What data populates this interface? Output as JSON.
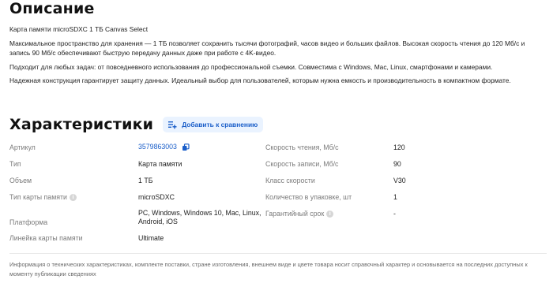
{
  "description": {
    "title": "Описание",
    "paragraphs": [
      "Карта памяти microSDXC 1 ТБ Canvas Select",
      "Максимальное пространство для хранения — 1 ТБ позволяет сохранить тысячи фотографий, часов видео и больших файлов. Высокая скорость чтения до 120 Мб/с и запись 90 Мб/с обеспечивают быструю передачу данных даже при работе с 4K-видео.",
      "Подходит для любых задач: от повседневного использования до профессиональной съемки. Совместима с Windows, Mac, Linux, смартфонами и камерами.",
      "Надежная конструкция гарантирует защиту данных. Идеальный выбор для пользователей, которым нужна емкость и производительность в компактном формате."
    ]
  },
  "specs": {
    "title": "Характеристики",
    "compare_label": "Добавить к сравнению",
    "left": [
      {
        "label": "Артикул",
        "value": "3579863003"
      },
      {
        "label": "Тип",
        "value": "Карта памяти"
      },
      {
        "label": "Объем",
        "value": "1 ТБ"
      },
      {
        "label": "Тип карты памяти",
        "value": "microSDXC"
      },
      {
        "label": "Платформа",
        "value": "PC, Windows, Windows 10, Mac, Linux, Android, iOS"
      },
      {
        "label": "Линейка карты памяти",
        "value": "Ultimate"
      }
    ],
    "right": [
      {
        "label": "Скорость чтения, Мб/с",
        "value": "120"
      },
      {
        "label": "Скорость записи, Мб/с",
        "value": "90"
      },
      {
        "label": "Класс скорости",
        "value": "V30"
      },
      {
        "label": "Количество в упаковке, шт",
        "value": "1"
      },
      {
        "label": "Гарантийный срок",
        "value": "-"
      }
    ]
  },
  "footnote": "Информация о технических характеристиках, комплекте поставки, стране изготовления, внешнем виде и цвете товара носит справочный характер и основывается на последних доступных к моменту публикации сведениях",
  "colors": {
    "accent": "#1a5ec9",
    "accent_bg": "#eaf3ff",
    "label": "#7b7b7b"
  }
}
